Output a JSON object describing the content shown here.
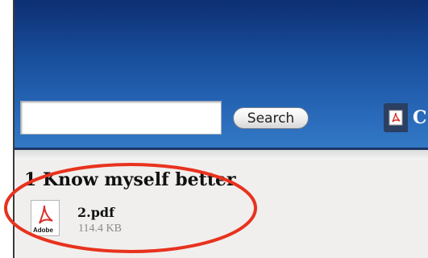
{
  "search": {
    "placeholder": "",
    "value": "",
    "button_label": "Search"
  },
  "header_link": {
    "label": "C",
    "icon": "pdf-icon"
  },
  "section": {
    "title": "1 Know myself better"
  },
  "file": {
    "name": "2.pdf",
    "size": "114.4 KB",
    "icon": "adobe-pdf-icon",
    "icon_label": "Adobe"
  },
  "colors": {
    "header_top": "#0e2f73",
    "header_bottom": "#3279c4",
    "content_bg": "#f0efed",
    "annotation": "#e8321e"
  }
}
